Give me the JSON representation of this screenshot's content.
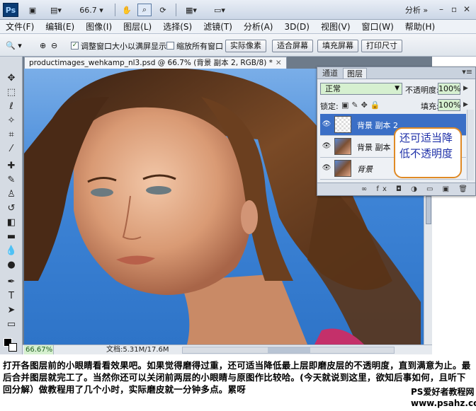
{
  "appbar": {
    "logo": "Ps",
    "zoom": "66.7",
    "workspace": "分析",
    "icons": [
      "bridge-icon",
      "film-icon",
      "hand-icon",
      "zoom-icon",
      "rotate-icon",
      "layout-icon",
      "screen-mode-icon"
    ]
  },
  "menu": [
    "文件(F)",
    "编辑(E)",
    "图像(I)",
    "图层(L)",
    "选择(S)",
    "滤镜(T)",
    "分析(A)",
    "3D(D)",
    "视图(V)",
    "窗口(W)",
    "帮助(H)"
  ],
  "options": {
    "resize_windows": "调整窗口大小以满屏显示",
    "zoom_all_windows": "缩放所有窗口",
    "actual_pixels": "实际像素",
    "fit_screen": "适合屏幕",
    "fill_screen": "填充屏幕",
    "print_size": "打印尺寸"
  },
  "document": {
    "tab_title": "productimages_wehkamp_nl3.psd @ 66.7% (背景 副本 2, RGB/8) *",
    "zoom_status": "66.67%",
    "doc_info": "文档:5.31M/17.6M"
  },
  "layers_panel": {
    "tabs": [
      "通道",
      "图层"
    ],
    "blend_mode": "正常",
    "opacity_label": "不透明度:",
    "opacity_value": "100%",
    "lock_label": "锁定:",
    "fill_label": "填充:",
    "fill_value": "100%",
    "layers": [
      {
        "name": "背景 副本 2",
        "selected": true
      },
      {
        "name": "背景 副本",
        "selected": false
      },
      {
        "name": "背景",
        "selected": false
      }
    ]
  },
  "callout_text": "还可适当降低不透明度",
  "caption": "打开各图层前的小眼睛看看效果吧。如果觉得磨得过重，还可适当降低最上层即磨皮层的不透明度，直到满意为止。最后合并图层就完工了。当然你还可以关闭前两层的小眼睛与原图作比较哈。(今天就说到这里，欲知后事如何，且听下回分解）做教程用了几个小时，实际磨皮就一分钟多点。累呀",
  "credit_line1": "PS爱好者教程网",
  "credit_line2": "www.psahz.com"
}
